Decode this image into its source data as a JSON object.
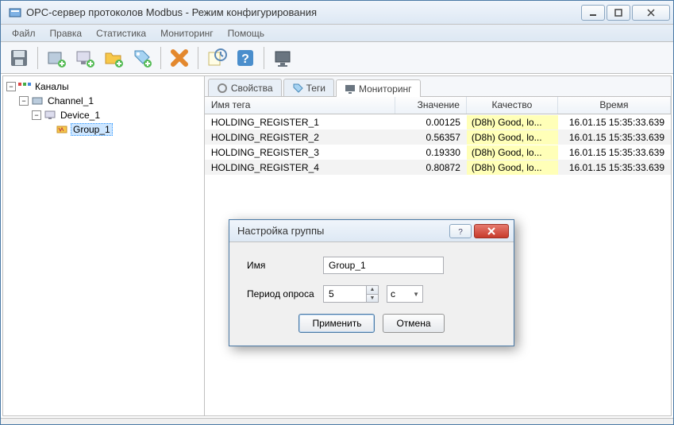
{
  "window": {
    "title": "OPC-сервер протоколов Modbus - Режим конфигурирования"
  },
  "menu": {
    "file": "Файл",
    "edit": "Правка",
    "stats": "Статистика",
    "monitoring": "Мониторинг",
    "help": "Помощь"
  },
  "tree": {
    "root": "Каналы",
    "channel": "Channel_1",
    "device": "Device_1",
    "group": "Group_1"
  },
  "tabs": {
    "props": "Свойства",
    "tags": "Теги",
    "monitoring": "Мониторинг"
  },
  "table": {
    "headers": {
      "name": "Имя тега",
      "value": "Значение",
      "quality": "Качество",
      "time": "Время"
    },
    "rows": [
      {
        "name": "HOLDING_REGISTER_1",
        "value": "0.00125",
        "quality": "(D8h) Good, lo...",
        "time": "16.01.15 15:35:33.639"
      },
      {
        "name": "HOLDING_REGISTER_2",
        "value": "0.56357",
        "quality": "(D8h) Good, lo...",
        "time": "16.01.15 15:35:33.639"
      },
      {
        "name": "HOLDING_REGISTER_3",
        "value": "0.19330",
        "quality": "(D8h) Good, lo...",
        "time": "16.01.15 15:35:33.639"
      },
      {
        "name": "HOLDING_REGISTER_4",
        "value": "0.80872",
        "quality": "(D8h) Good, lo...",
        "time": "16.01.15 15:35:33.639"
      }
    ]
  },
  "dialog": {
    "title": "Настройка группы",
    "name_label": "Имя",
    "name_value": "Group_1",
    "period_label": "Период опроса",
    "period_value": "5",
    "unit_value": "с",
    "apply": "Применить",
    "cancel": "Отмена"
  }
}
